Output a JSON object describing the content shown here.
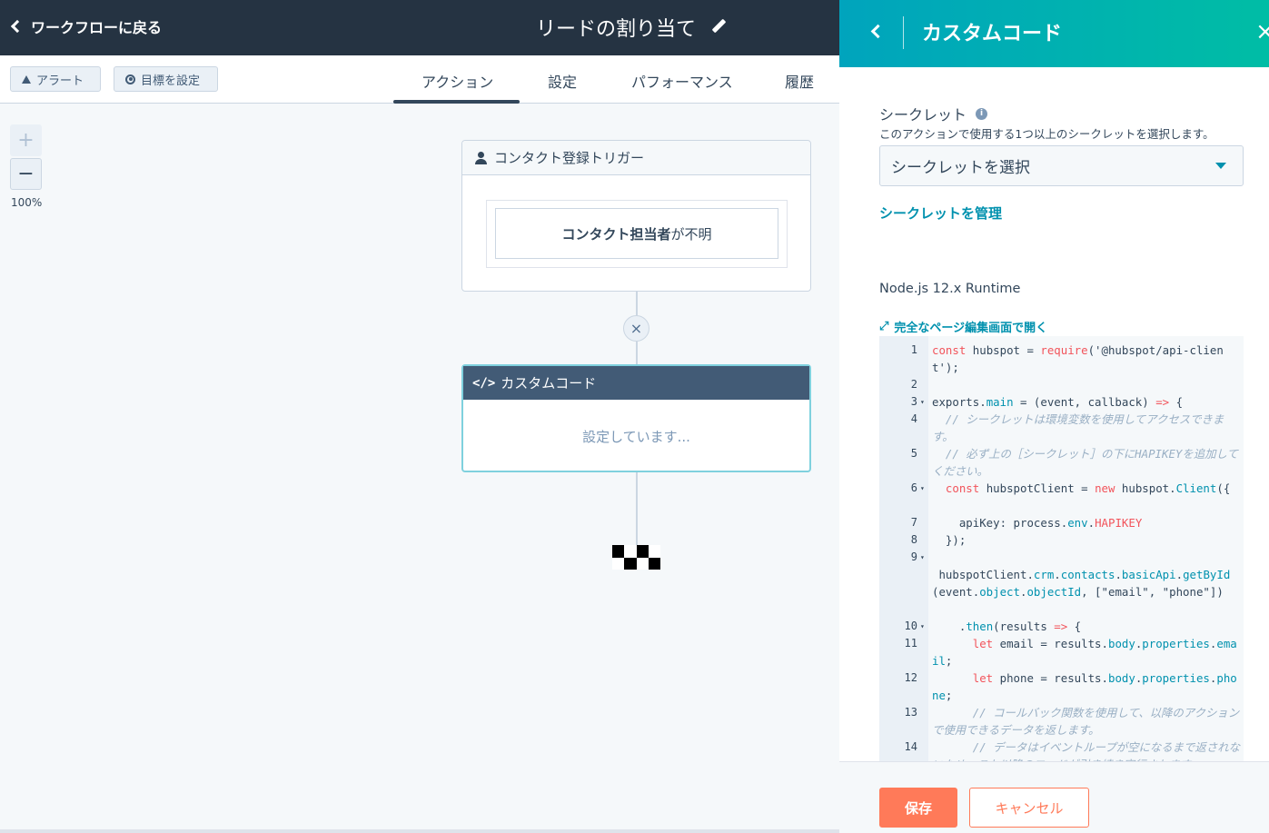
{
  "topbar": {
    "back_label": "ワークフローに戻る",
    "workflow_title": "リードの割り当て"
  },
  "subbar": {
    "alert_label": "アラート",
    "goal_label": "目標を設定",
    "tabs": [
      {
        "label": "アクション",
        "active": true
      },
      {
        "label": "設定"
      },
      {
        "label": "パフォーマンス"
      },
      {
        "label": "履歴"
      }
    ]
  },
  "canvas": {
    "zoom_in": "+",
    "zoom_out": "−",
    "zoom_level": "100%",
    "trigger_card": {
      "title": "コンタクト登録トリガー",
      "filter_bold": "コンタクト担当者",
      "filter_rest": "が不明"
    },
    "remove_icon": "×",
    "code_card": {
      "title": "カスタムコード",
      "status": "設定しています..."
    }
  },
  "panel": {
    "title": "カスタムコード",
    "close": "×",
    "secret_label": "シークレット",
    "secret_help": "このアクションで使用する1つ以上のシークレットを選択します。",
    "secret_select": "シークレットを選択",
    "manage_secrets": "シークレットを管理",
    "runtime": "Node.js 12.x Runtime",
    "open_full_page": "完全なページ編集画面で開く",
    "code_lines": [
      {
        "n": "1",
        "fold": false,
        "text": "const hubspot = require('@hubspot/api-client');"
      },
      {
        "n": "2",
        "fold": false,
        "text": ""
      },
      {
        "n": "3",
        "fold": true,
        "text": "exports.main = (event, callback) => {"
      },
      {
        "n": "4",
        "fold": false,
        "text": "  // シークレットは環境変数を使用してアクセスできます。"
      },
      {
        "n": "5",
        "fold": false,
        "text": "  // 必ず上の［シークレット］の下にHAPIKEYを追加してください。"
      },
      {
        "n": "6",
        "fold": true,
        "text": "  const hubspotClient = new hubspot.Client({"
      },
      {
        "n": "7",
        "fold": false,
        "text": "    apiKey: process.env.HAPIKEY"
      },
      {
        "n": "8",
        "fold": false,
        "text": "  });"
      },
      {
        "n": "9",
        "fold": true,
        "text": "\n hubspotClient.crm.contacts.basicApi.getById(event.object.objectId, [\"email\", \"phone\"])"
      },
      {
        "n": "10",
        "fold": true,
        "text": "    .then(results => {"
      },
      {
        "n": "11",
        "fold": false,
        "text": "      let email = results.body.properties.email;"
      },
      {
        "n": "12",
        "fold": false,
        "text": "      let phone = results.body.properties.phone;"
      },
      {
        "n": "13",
        "fold": false,
        "text": "      // コールバック関数を使用して、以降のアクションで使用できるデータを返します。"
      },
      {
        "n": "14",
        "fold": false,
        "text": "      // データはイベントループが空になるまで返されないため、これ以降のコードが引き続き実行されます。"
      }
    ],
    "save_label": "保存",
    "cancel_label": "キャンセル"
  }
}
